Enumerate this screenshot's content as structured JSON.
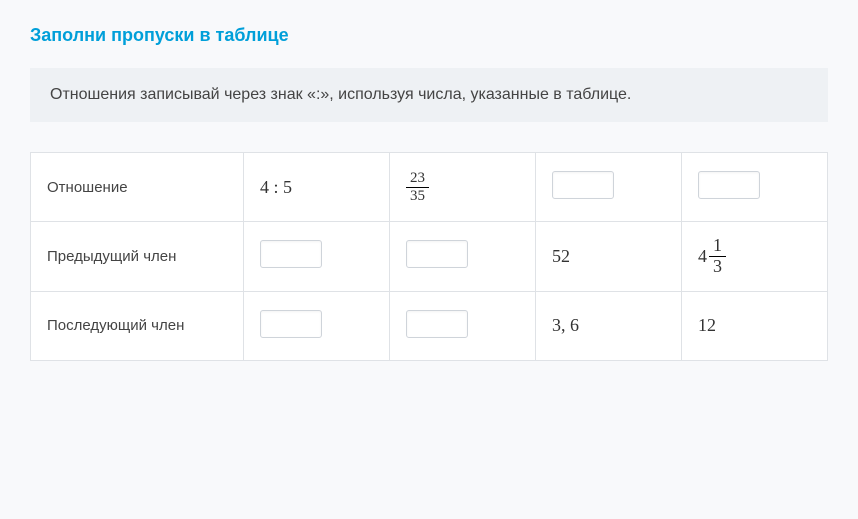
{
  "title": "Заполни пропуски в таблице",
  "hint": "Отношения записывай через знак «:», используя числа, указанные в таблице.",
  "rows": {
    "r1_label": "Отношение",
    "r2_label": "Предыдущий член",
    "r3_label": "Последующий член"
  },
  "cells": {
    "r1c1": "4 : 5",
    "frac_num": "23",
    "frac_den": "35",
    "r2c3": "52",
    "mixed_whole": "4",
    "mixed_num": "1",
    "mixed_den": "3",
    "r3c3": "3, 6",
    "r3c4": "12"
  }
}
